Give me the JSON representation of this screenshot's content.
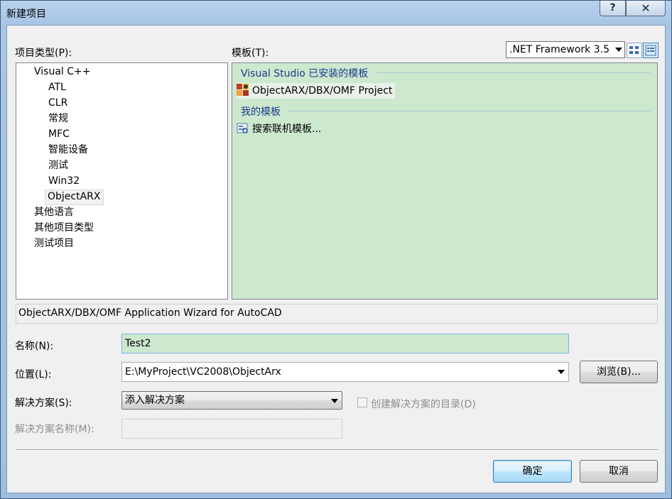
{
  "window": {
    "title": "新建项目",
    "help_glyph": "?",
    "close_glyph": "✕"
  },
  "labels": {
    "project_types": "项目类型(P):",
    "templates": "模板(T):",
    "name": "名称(N):",
    "location": "位置(L):",
    "solution": "解决方案(S):",
    "solution_name": "解决方案名称(M):",
    "create_dir": "创建解决方案的目录(D)"
  },
  "project_types": [
    {
      "label": "Visual C++",
      "level": 0
    },
    {
      "label": "ATL",
      "level": 1
    },
    {
      "label": "CLR",
      "level": 1
    },
    {
      "label": "常规",
      "level": 1
    },
    {
      "label": "MFC",
      "level": 1
    },
    {
      "label": "智能设备",
      "level": 1
    },
    {
      "label": "测试",
      "level": 1
    },
    {
      "label": "Win32",
      "level": 1
    },
    {
      "label": "ObjectARX",
      "level": 1,
      "selected": true
    },
    {
      "label": "其他语言",
      "level": 0
    },
    {
      "label": "其他项目类型",
      "level": 0
    },
    {
      "label": "测试项目",
      "level": 0
    }
  ],
  "framework": {
    "selected": ".NET Framework 3.5"
  },
  "template_groups": [
    {
      "header": "Visual Studio 已安装的模板",
      "items": [
        {
          "label": "ObjectARX/DBX/OMF Project",
          "icon": "arx-template-icon",
          "selected": true
        }
      ]
    },
    {
      "header": "我的模板",
      "items": [
        {
          "label": "搜索联机模板...",
          "icon": "search-online-icon"
        }
      ]
    }
  ],
  "description": "ObjectARX/DBX/OMF Application Wizard for AutoCAD",
  "fields": {
    "name_value": "Test2",
    "location_value": "E:\\MyProject\\VC2008\\ObjectArx",
    "solution_value": "添入解决方案",
    "solution_name_value": ""
  },
  "buttons": {
    "browse": "浏览(B)...",
    "ok": "确定",
    "cancel": "取消"
  },
  "colors": {
    "template_bg": "#cce8cf",
    "title_bg": "#a9c6e6"
  }
}
